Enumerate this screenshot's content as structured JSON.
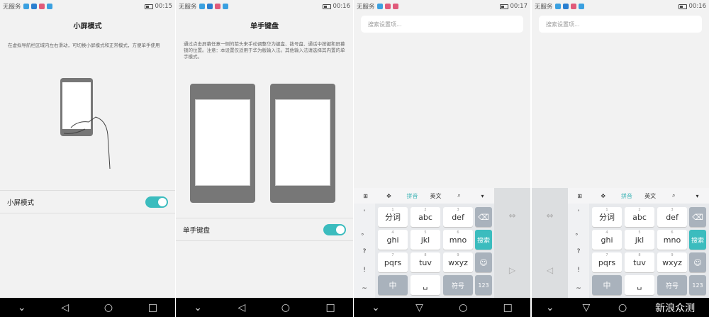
{
  "statusbar": [
    {
      "carrier": "无服务",
      "time": "00:15"
    },
    {
      "carrier": "无服务",
      "time": "00:16"
    },
    {
      "carrier": "无服务",
      "time": "00:17"
    },
    {
      "carrier": "无服务",
      "time": "00:16"
    }
  ],
  "panel1": {
    "title": "小屏模式",
    "desc": "在虚拟导航栏区域内左右滑动，可切换小屏模式和正常模式，方便单手使用",
    "row_label": "小屏模式"
  },
  "panel2": {
    "title": "单手键盘",
    "desc": "通过点击屏幕任意一侧的箭头来手动调整华为键盘、拨号盘、通话中按键和屏幕锁的位置。注意：本设置仅适用于华为版输入法。其他输入法请选择其内置的单手模式。",
    "row_label": "单手键盘"
  },
  "search": {
    "placeholder": "搜索设置项..."
  },
  "keyboard": {
    "top": [
      "拼音",
      "英文"
    ],
    "left_col": [
      "'",
      "。",
      "?",
      "!",
      "~"
    ],
    "keys": [
      {
        "n": "1",
        "l": "分词"
      },
      {
        "n": "2",
        "l": "abc"
      },
      {
        "n": "3",
        "l": "def"
      },
      {
        "n": "4",
        "l": "ghi"
      },
      {
        "n": "5",
        "l": "jkl"
      },
      {
        "n": "6",
        "l": "mno"
      },
      {
        "n": "7",
        "l": "pqrs"
      },
      {
        "n": "8",
        "l": "tuv"
      },
      {
        "n": "9",
        "l": "wxyz"
      }
    ],
    "search_key": "搜索",
    "zhong": "中",
    "symbol": "符号",
    "num": "123"
  },
  "watermark": "新浪众测"
}
